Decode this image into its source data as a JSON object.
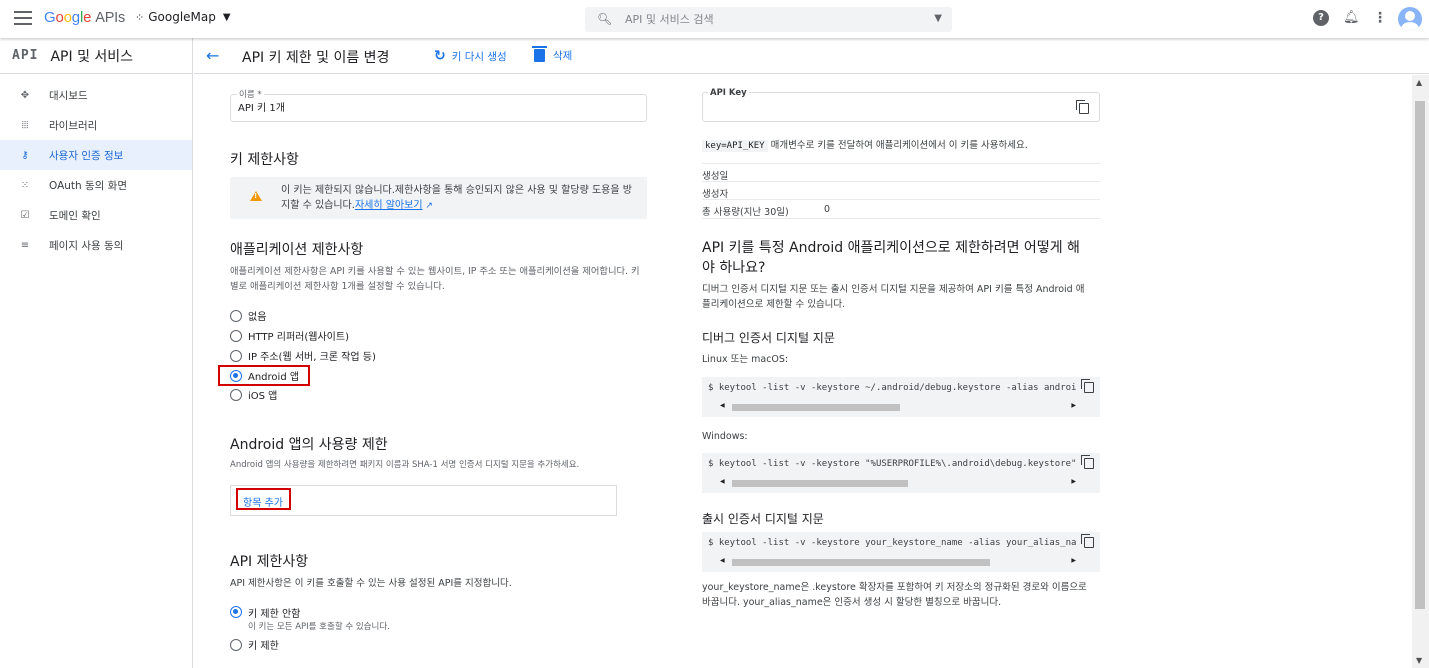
{
  "topbar": {
    "logo_google": "Google",
    "logo_apis": "APIs",
    "project": "GoogleMap",
    "search_placeholder": "API 및 서비스 검색"
  },
  "sidebar": {
    "badge": "API",
    "title": "API 및 서비스",
    "items": [
      {
        "label": "대시보드",
        "icon": "dashboard-icon",
        "active": false
      },
      {
        "label": "라이브러리",
        "icon": "library-icon",
        "active": false
      },
      {
        "label": "사용자 인증 정보",
        "icon": "key-icon",
        "active": true
      },
      {
        "label": "OAuth 동의 화면",
        "icon": "oauth-icon",
        "active": false
      },
      {
        "label": "도메인 확인",
        "icon": "domain-check-icon",
        "active": false
      },
      {
        "label": "페이지 사용 동의",
        "icon": "page-agreement-icon",
        "active": false
      }
    ]
  },
  "header": {
    "title": "API 키 제한 및 이름 변경",
    "regenerate": "키 다시 생성",
    "delete": "삭제"
  },
  "form": {
    "name_label": "이름 *",
    "name_value": "API 키 1개",
    "key_restrictions_title": "키 제한사항",
    "warning_text": "이 키는 제한되지 않습니다.제한사항을 통해 승인되지 않은 사용 및 할당량 도용을 방지할 수 있습니다.",
    "warning_link": "자세히 알아보기",
    "app_restrictions_title": "애플리케이션 제한사항",
    "app_restrictions_desc": "애플리케이션 제한사항은 API 키를 사용할 수 있는 웹사이트, IP 주소 또는 애플리케이션을 제어합니다. 키별로 애플리케이션 제한사항 1개를 설정할 수 있습니다.",
    "app_options": [
      {
        "label": "없음",
        "selected": false
      },
      {
        "label": "HTTP 리퍼러(웹사이트)",
        "selected": false
      },
      {
        "label": "IP 주소(웹 서버, 크론 작업 등)",
        "selected": false
      },
      {
        "label": "Android 앱",
        "selected": true
      },
      {
        "label": "iOS 앱",
        "selected": false
      }
    ],
    "android_title": "Android 앱의 사용량 제한",
    "android_desc": "Android 앱의 사용량을 제한하려면 패키지 이름과 SHA-1 서명 인증서 디지털 지문을 추가하세요.",
    "add_item": "항목 추가",
    "api_restrictions_title": "API 제한사항",
    "api_restrictions_desc": "API 제한사항은 이 키를 호출할 수 있는 사용 설정된 API를 지정합니다.",
    "api_options": [
      {
        "label": "키 제한 안함",
        "sub": "이 키는 모든 API를 호출할 수 있습니다.",
        "selected": true
      },
      {
        "label": "키 제한",
        "sub": "",
        "selected": false
      }
    ]
  },
  "keypanel": {
    "api_key_label": "API Key",
    "key_param": "key=API_KEY",
    "key_usage": "매개변수로 키를 전달하여 애플리케이션에서 이 키를 사용하세요.",
    "created_label": "생성일",
    "creator_label": "생성자",
    "usage_label": "총 사용량(지난 30일)",
    "usage_value": "0",
    "question": "API 키를 특정 Android 애플리케이션으로 제한하려면 어떻게 해야 하나요?",
    "question_desc": "디버그 인증서 디지털 지문 또는 출시 인증서 디지털 지문을 제공하여 API 키를 특정 Android 애플리케이션으로 제한할 수 있습니다.",
    "debug_title": "디버그 인증서 디지털 지문",
    "linux_label": "Linux 또는 macOS:",
    "linux_cmd": "$ keytool -list -v -keystore ~/.android/debug.keystore -alias androi",
    "windows_label": "Windows:",
    "windows_cmd": "$ keytool -list -v -keystore \"%USERPROFILE%\\.android\\debug.keystore\"",
    "release_title": "출시 인증서 디지털 지문",
    "release_cmd": "$ keytool -list -v -keystore your_keystore_name -alias your_alias_na",
    "release_desc": "your_keystore_name은 .keystore 확장자를 포함하여 키 저장소의 정규화된 경로와 이름으로 바꿉니다. your_alias_name은 인증서 생성 시 할당한 별칭으로 바꿉니다."
  },
  "colors": {
    "accent": "#1a73e8",
    "highlight": "#d40000",
    "warning": "#f29900"
  }
}
